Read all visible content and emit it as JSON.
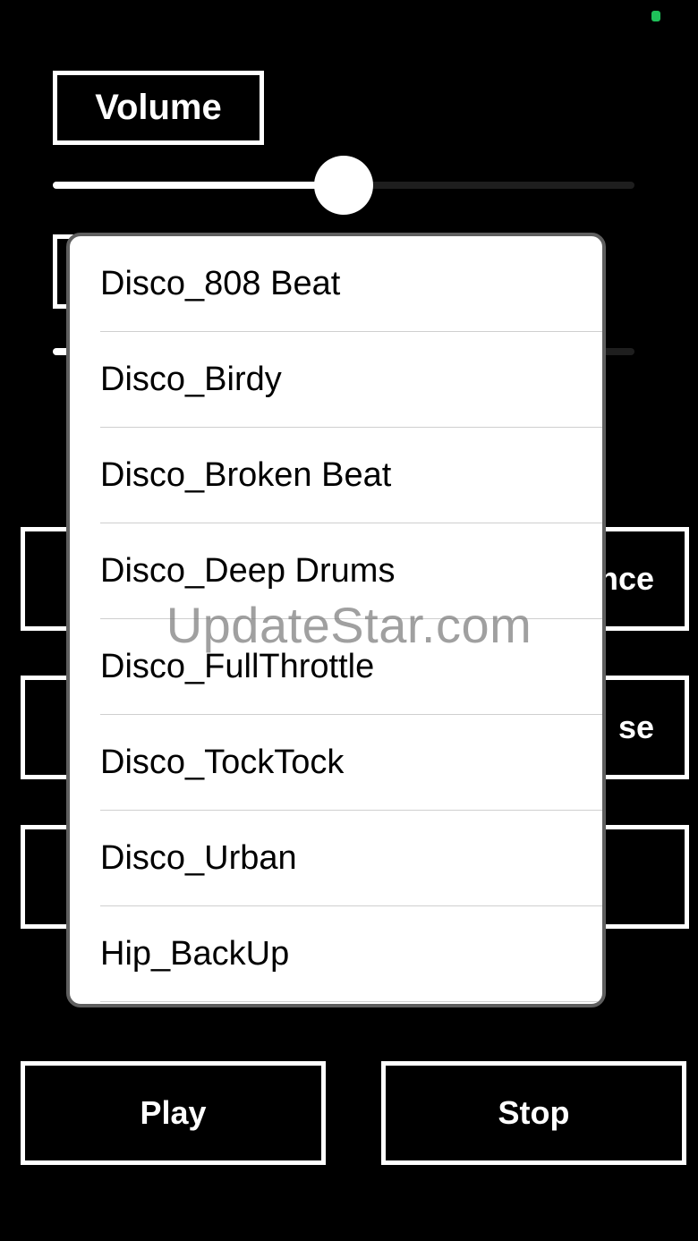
{
  "status": {
    "indicator_color": "#1fc25a"
  },
  "volume": {
    "label": "Volume",
    "slider_value_pct": 50
  },
  "second_slider": {
    "value_pct": 0
  },
  "behind_buttons": {
    "row1_right": "nce",
    "row2_right": "se",
    "row3_right": ""
  },
  "popup": {
    "items": [
      "Disco_808 Beat",
      "Disco_Birdy",
      "Disco_Broken Beat",
      "Disco_Deep Drums",
      "Disco_FullThrottle",
      "Disco_TockTock",
      "Disco_Urban",
      "Hip_BackUp"
    ]
  },
  "transport": {
    "play_label": "Play",
    "stop_label": "Stop"
  },
  "watermark": "UpdateStar.com"
}
